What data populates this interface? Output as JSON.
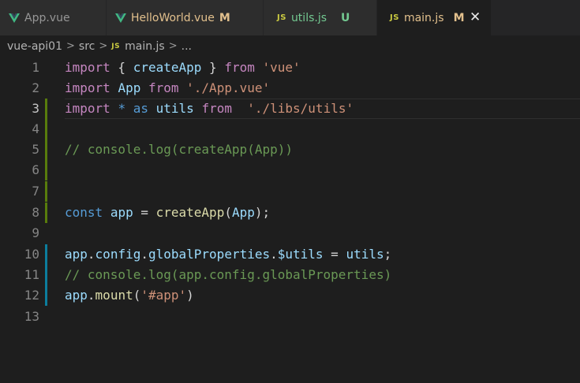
{
  "tabs": [
    {
      "icon": "vue-icon",
      "name": "App.vue",
      "status": "",
      "active": false
    },
    {
      "icon": "vue-icon",
      "name": "HelloWorld.vue",
      "status": "M",
      "active": false
    },
    {
      "icon": "js-icon",
      "name": "utils.js",
      "status": "U",
      "active": false
    },
    {
      "icon": "js-icon",
      "name": "main.js",
      "status": "M",
      "active": true,
      "close": "✕"
    }
  ],
  "breadcrumb": {
    "project": "vue-api01",
    "folder": "src",
    "js_badge": "JS",
    "file": "main.js",
    "more": "..."
  },
  "editor": {
    "current_line": 3,
    "lines": [
      {
        "n": "1",
        "text": "import { createApp } from 'vue'"
      },
      {
        "n": "2",
        "text": "import App from './App.vue'"
      },
      {
        "n": "3",
        "text": "import * as utils from  './libs/utils'"
      },
      {
        "n": "4",
        "text": ""
      },
      {
        "n": "5",
        "text": "// console.log(createApp(App))"
      },
      {
        "n": "6",
        "text": ""
      },
      {
        "n": "7",
        "text": ""
      },
      {
        "n": "8",
        "text": "const app = createApp(App);"
      },
      {
        "n": "9",
        "text": ""
      },
      {
        "n": "10",
        "text": "app.config.globalProperties.$utils = utils;"
      },
      {
        "n": "11",
        "text": "// console.log(app.config.globalProperties)"
      },
      {
        "n": "12",
        "text": "app.mount('#app')"
      },
      {
        "n": "13",
        "text": ""
      }
    ]
  },
  "colors": {
    "added_gutter": "#587c0c",
    "modified_gutter": "#0c7d9d",
    "vue_green": "#41b883",
    "modified_status": "#e2c08d",
    "untracked_status": "#73c991"
  }
}
